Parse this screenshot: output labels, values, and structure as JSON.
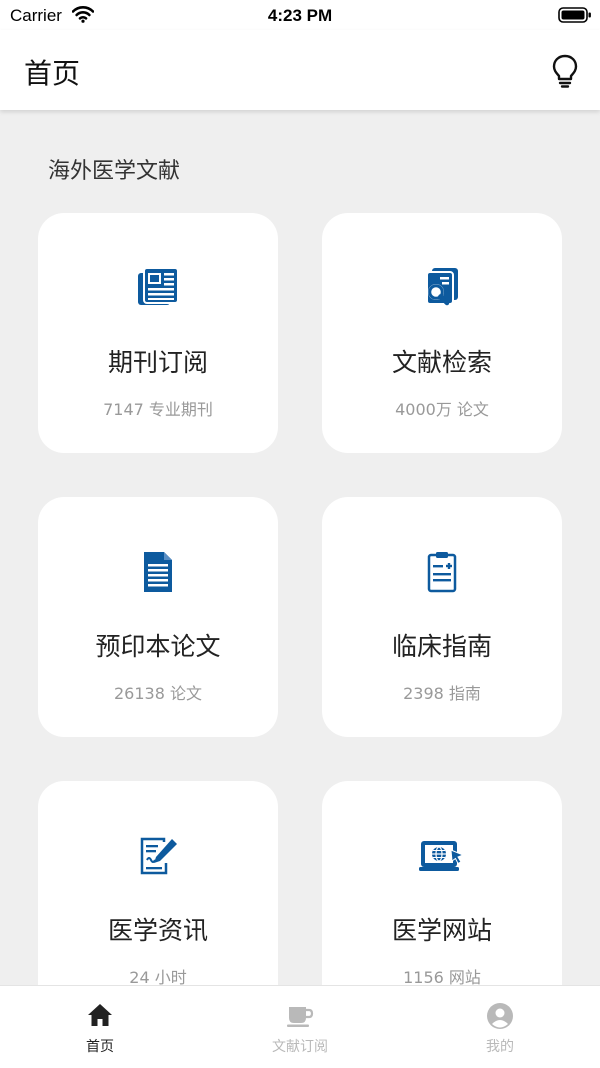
{
  "status_bar": {
    "carrier": "Carrier",
    "time": "4:23 PM"
  },
  "header": {
    "title": "首页",
    "action_icon": "lightbulb-icon"
  },
  "section": {
    "title": "海外医学文献"
  },
  "cards": [
    {
      "label": "期刊订阅",
      "count": "7147 专业期刊",
      "icon": "newspaper-icon"
    },
    {
      "label": "文献检索",
      "count": "4000万 论文",
      "icon": "document-search-icon"
    },
    {
      "label": "预印本论文",
      "count": "26138 论文",
      "icon": "document-lines-icon"
    },
    {
      "label": "临床指南",
      "count": "2398 指南",
      "icon": "clipboard-plus-icon"
    },
    {
      "label": "医学资讯",
      "count": "24 小时",
      "icon": "edit-document-icon"
    },
    {
      "label": "医学网站",
      "count": "1156 网站",
      "icon": "web-monitor-icon"
    }
  ],
  "tab_bar": {
    "tabs": [
      {
        "label": "首页",
        "icon": "home-icon",
        "active": true
      },
      {
        "label": "文献订阅",
        "icon": "coffee-cup-icon",
        "active": false
      },
      {
        "label": "我的",
        "icon": "user-avatar-icon",
        "active": false
      }
    ]
  },
  "colors": {
    "accent": "#0d5a9e",
    "background": "#efefef",
    "card": "#ffffff",
    "tab_active": "#222222",
    "tab_inactive": "#b9b9b9"
  }
}
